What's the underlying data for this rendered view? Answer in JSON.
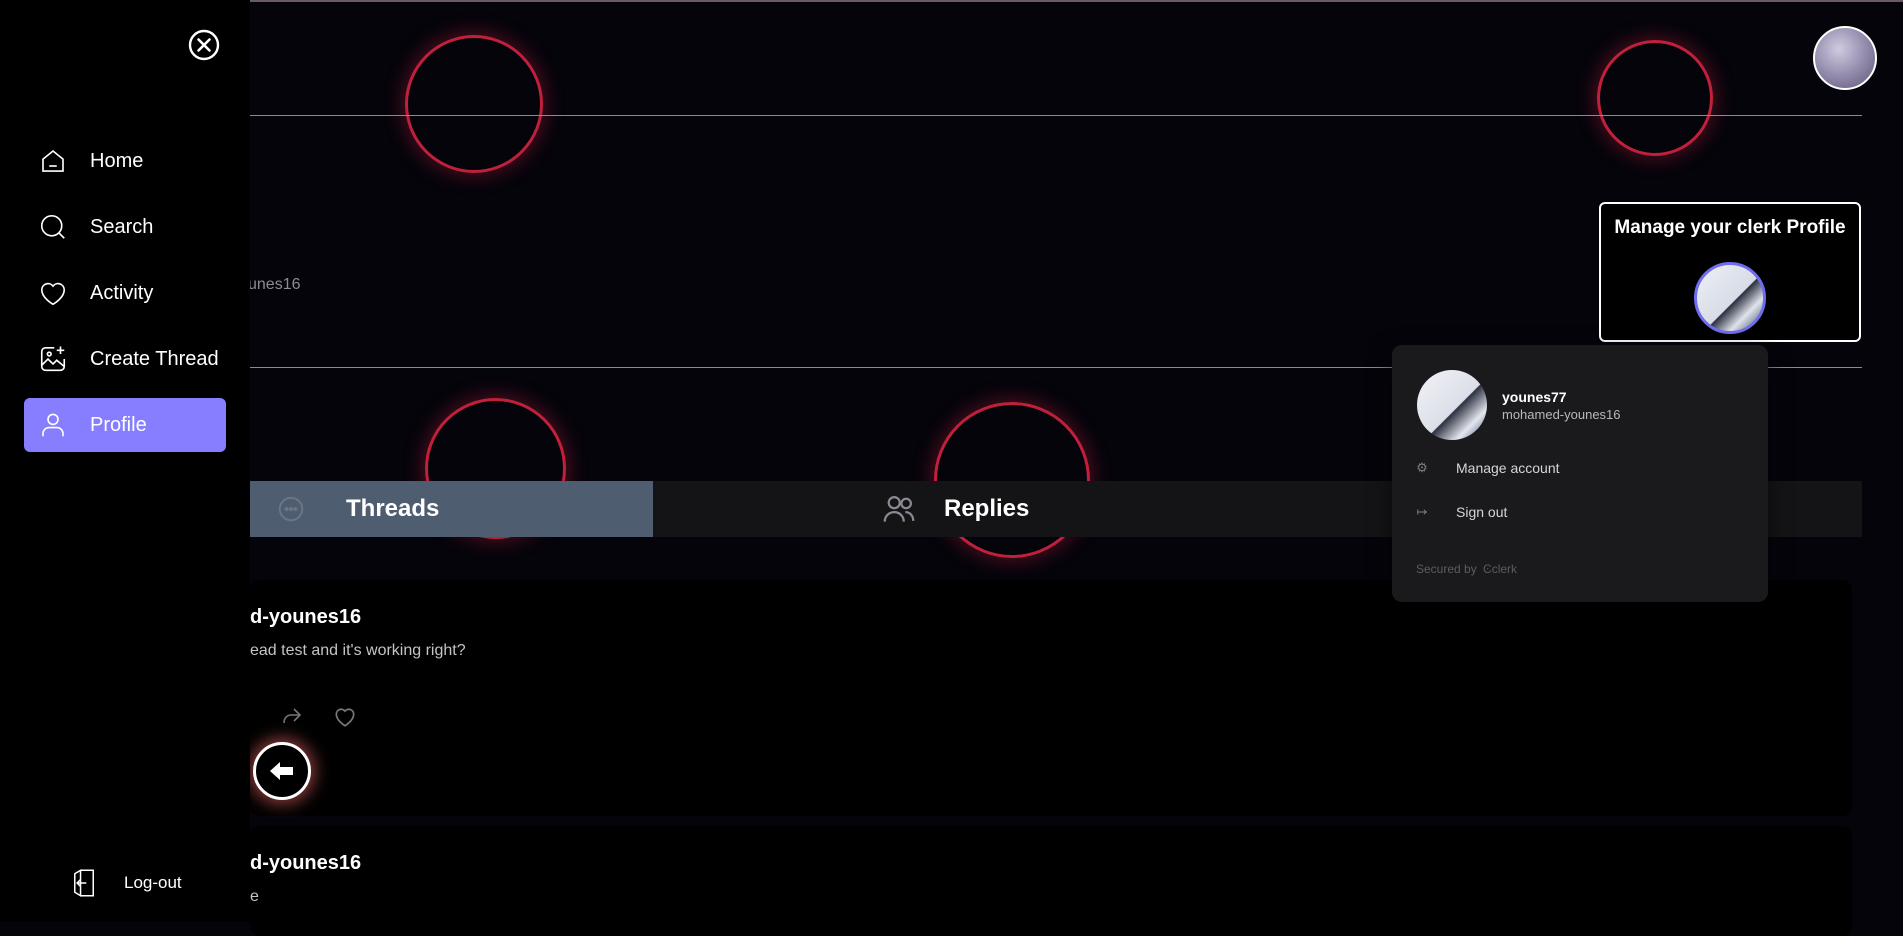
{
  "sidebar": {
    "items": [
      {
        "label": "Home",
        "icon": "home-icon"
      },
      {
        "label": "Search",
        "icon": "search-icon"
      },
      {
        "label": "Activity",
        "icon": "heart-icon"
      },
      {
        "label": "Create Thread",
        "icon": "image-plus-icon"
      },
      {
        "label": "Profile",
        "icon": "user-icon",
        "active": true
      }
    ],
    "logout_label": "Log-out"
  },
  "profile": {
    "handle_partial": "unes16"
  },
  "manage_card": {
    "title": "Manage your clerk Profile"
  },
  "user_menu": {
    "username": "younes77",
    "handle": "mohamed-younes16",
    "actions": [
      {
        "label": "Manage account",
        "icon": "gear-icon"
      },
      {
        "label": "Sign out",
        "icon": "sign-out-icon"
      }
    ],
    "secured_by": "Secured by",
    "secured_brand": "clerk"
  },
  "tabs": [
    {
      "label": "Threads",
      "icon": "chat-bubble-icon",
      "active": true
    },
    {
      "label": "Replies",
      "icon": "users-icon",
      "active": false
    }
  ],
  "threads": [
    {
      "author": "d-younes16",
      "body": "ead test and it's working right?"
    },
    {
      "author": "d-younes16",
      "body": "e"
    }
  ],
  "colors": {
    "accent": "#877eff",
    "ring": "#c0203b",
    "active_tab": "#4f5d70"
  }
}
